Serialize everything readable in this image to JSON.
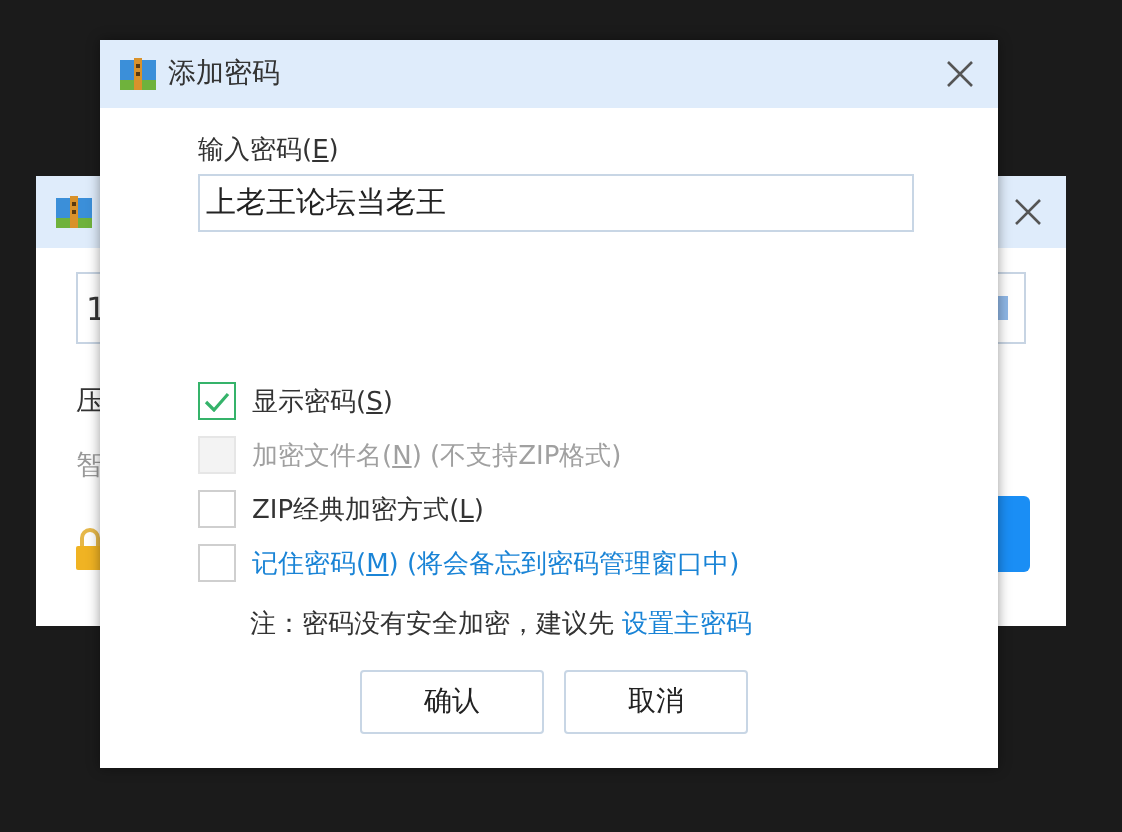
{
  "background_window": {
    "field_value": "1",
    "label_1": "压",
    "label_2": "智"
  },
  "dialog": {
    "title": "添加密码",
    "password": {
      "label_before": "输入密码(",
      "accel": "E",
      "label_after": ")",
      "value": "上老王论坛当老王"
    },
    "options": [
      {
        "kind": "plain",
        "before": "显示密码(",
        "accel": "S",
        "after": ")",
        "checked": true,
        "disabled": false
      },
      {
        "kind": "plain",
        "before": "加密文件名(",
        "accel": "N",
        "after": ") (不支持ZIP格式)",
        "checked": false,
        "disabled": true
      },
      {
        "kind": "plain",
        "before": "ZIP经典加密方式(",
        "accel": "L",
        "after": ")",
        "checked": false,
        "disabled": false
      },
      {
        "kind": "link",
        "before": "记住密码(",
        "accel": "M",
        "after": ") (将会备忘到密码管理窗口中)",
        "checked": false,
        "disabled": false
      }
    ],
    "note": "注：密码没有安全加密，建议先",
    "note_link": "设置主密码",
    "buttons": [
      "确认",
      "取消"
    ]
  }
}
